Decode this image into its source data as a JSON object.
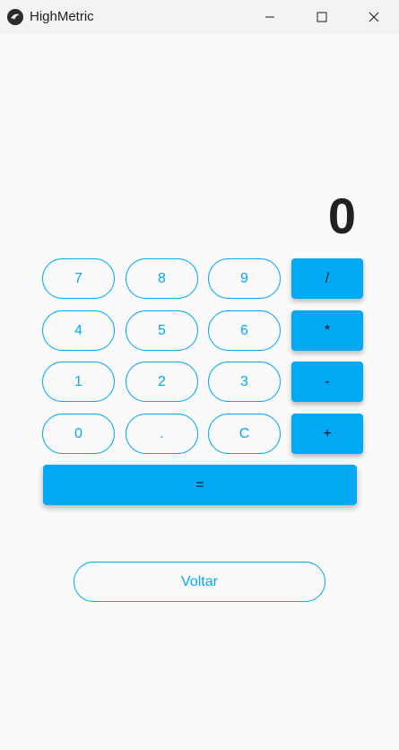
{
  "window": {
    "title": "HighMetric",
    "icon": "kivy-icon"
  },
  "display": {
    "value": "0"
  },
  "keypad": {
    "row1": [
      "7",
      "8",
      "9",
      "/"
    ],
    "row2": [
      "4",
      "5",
      "6",
      "*"
    ],
    "row3": [
      "1",
      "2",
      "3",
      "-"
    ],
    "row4": [
      "0",
      ".",
      "C",
      "+"
    ],
    "equals": "="
  },
  "back_button": {
    "label": "Voltar"
  },
  "colors": {
    "accent": "#03a9f4",
    "background": "#fafafa",
    "text_dark": "#212121"
  }
}
